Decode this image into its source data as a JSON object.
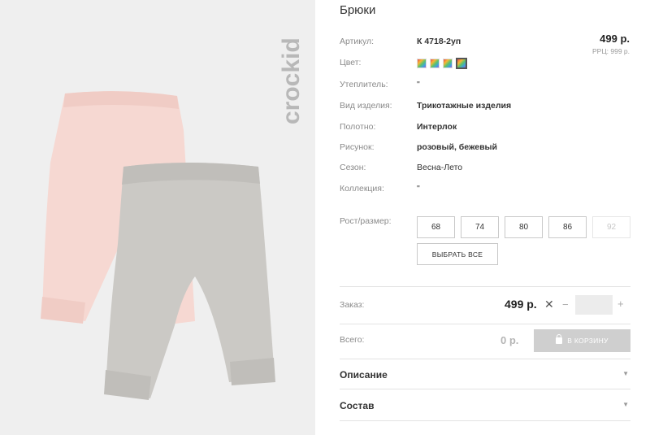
{
  "brand": "crockid",
  "product": {
    "title": "Брюки",
    "price": "499 р.",
    "rrp": "РРЦ: 999 р."
  },
  "attributes": [
    {
      "label": "Артикул:",
      "value": "К 4718-2уп",
      "bold": true
    },
    {
      "label": "Цвет:",
      "value": "",
      "bold": false
    },
    {
      "label": "Утеплитель:",
      "value": "\"",
      "bold": false
    },
    {
      "label": "Вид изделия:",
      "value": "Трикотажные изделия",
      "bold": true
    },
    {
      "label": "Полотно:",
      "value": "Интерлок",
      "bold": true
    },
    {
      "label": "Рисунок:",
      "value": "розовый, бежевый",
      "bold": true
    },
    {
      "label": "Сезон:",
      "value": "Весна-Лето",
      "bold": false
    },
    {
      "label": "Коллекция:",
      "value": "\"",
      "bold": false
    }
  ],
  "colors": [
    {
      "name": "multicolor-1",
      "selected": false
    },
    {
      "name": "multicolor-2",
      "selected": false
    },
    {
      "name": "multicolor-3",
      "selected": false
    },
    {
      "name": "multicolor-4",
      "selected": true
    }
  ],
  "sizes": {
    "label": "Рост/размер:",
    "options": [
      {
        "value": "68",
        "available": true
      },
      {
        "value": "74",
        "available": true
      },
      {
        "value": "80",
        "available": true
      },
      {
        "value": "86",
        "available": true
      },
      {
        "value": "92",
        "available": false
      }
    ],
    "select_all": "ВЫБРАТЬ ВСЕ"
  },
  "order": {
    "label": "Заказ:",
    "price": "499 р.",
    "times": "✕",
    "minus": "−",
    "plus": "+",
    "quantity": ""
  },
  "total": {
    "label": "Всего:",
    "sum": "0 р.",
    "cart_button": "В КОРЗИНУ"
  },
  "accordion": [
    {
      "label": "Описание"
    },
    {
      "label": "Состав"
    }
  ],
  "icons": {
    "chevron": "chevron-down-icon",
    "cart": "shopping-bag-icon"
  }
}
